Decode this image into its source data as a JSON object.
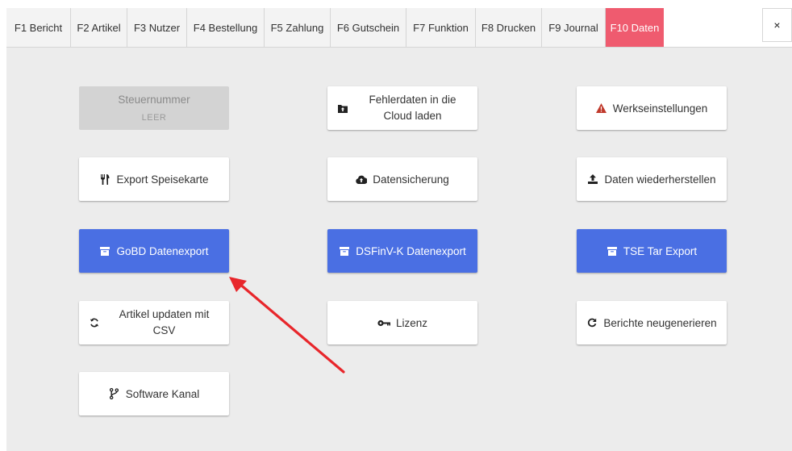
{
  "tabs": [
    {
      "label": "F1 Bericht"
    },
    {
      "label": "F2 Artikel"
    },
    {
      "label": "F3 Nutzer"
    },
    {
      "label": "F4 Bestellung"
    },
    {
      "label": "F5 Zahlung"
    },
    {
      "label": "F6 Gutschein"
    },
    {
      "label": "F7 Funktion"
    },
    {
      "label": "F8 Drucken"
    },
    {
      "label": "F9 Journal"
    },
    {
      "label": "F10 Daten",
      "active": true
    }
  ],
  "close_label": "×",
  "buttons": {
    "steuernummer": {
      "label": "Steuernummer",
      "value": "LEER"
    },
    "fehlerdaten": {
      "label": "Fehlerdaten in die Cloud laden",
      "line1": "Fehlerdaten in die",
      "line2": "Cloud laden",
      "icon": "folder-upload-icon"
    },
    "werkseinstellungen": {
      "label": "Werkseinstellungen",
      "icon": "warning-icon",
      "icon_color": "#c0392b"
    },
    "export_speisekarte": {
      "label": "Export Speisekarte",
      "icon": "utensils-icon"
    },
    "datensicherung": {
      "label": "Datensicherung",
      "icon": "cloud-upload-icon"
    },
    "daten_wiederherstellen": {
      "label": "Daten wiederherstellen",
      "icon": "upload-icon"
    },
    "gobd": {
      "label": "GoBD Datenexport",
      "icon": "archive-icon"
    },
    "dsfinv": {
      "label": "DSFinV-K Datenexport",
      "icon": "archive-icon"
    },
    "tse": {
      "label": "TSE Tar Export",
      "icon": "archive-icon"
    },
    "artikel_updaten": {
      "label": "Artikel updaten mit CSV",
      "line1": "Artikel updaten mit",
      "line2": "CSV",
      "icon": "sync-icon"
    },
    "lizenz": {
      "label": "Lizenz",
      "icon": "key-icon"
    },
    "berichte": {
      "label": "Berichte neugenerieren",
      "icon": "refresh-icon"
    },
    "software_kanal": {
      "label": "Software Kanal",
      "icon": "code-branch-icon"
    }
  },
  "colors": {
    "active_tab": "#ef5b6f",
    "primary_button": "#4a6fe3",
    "arrow": "#e8262b"
  }
}
